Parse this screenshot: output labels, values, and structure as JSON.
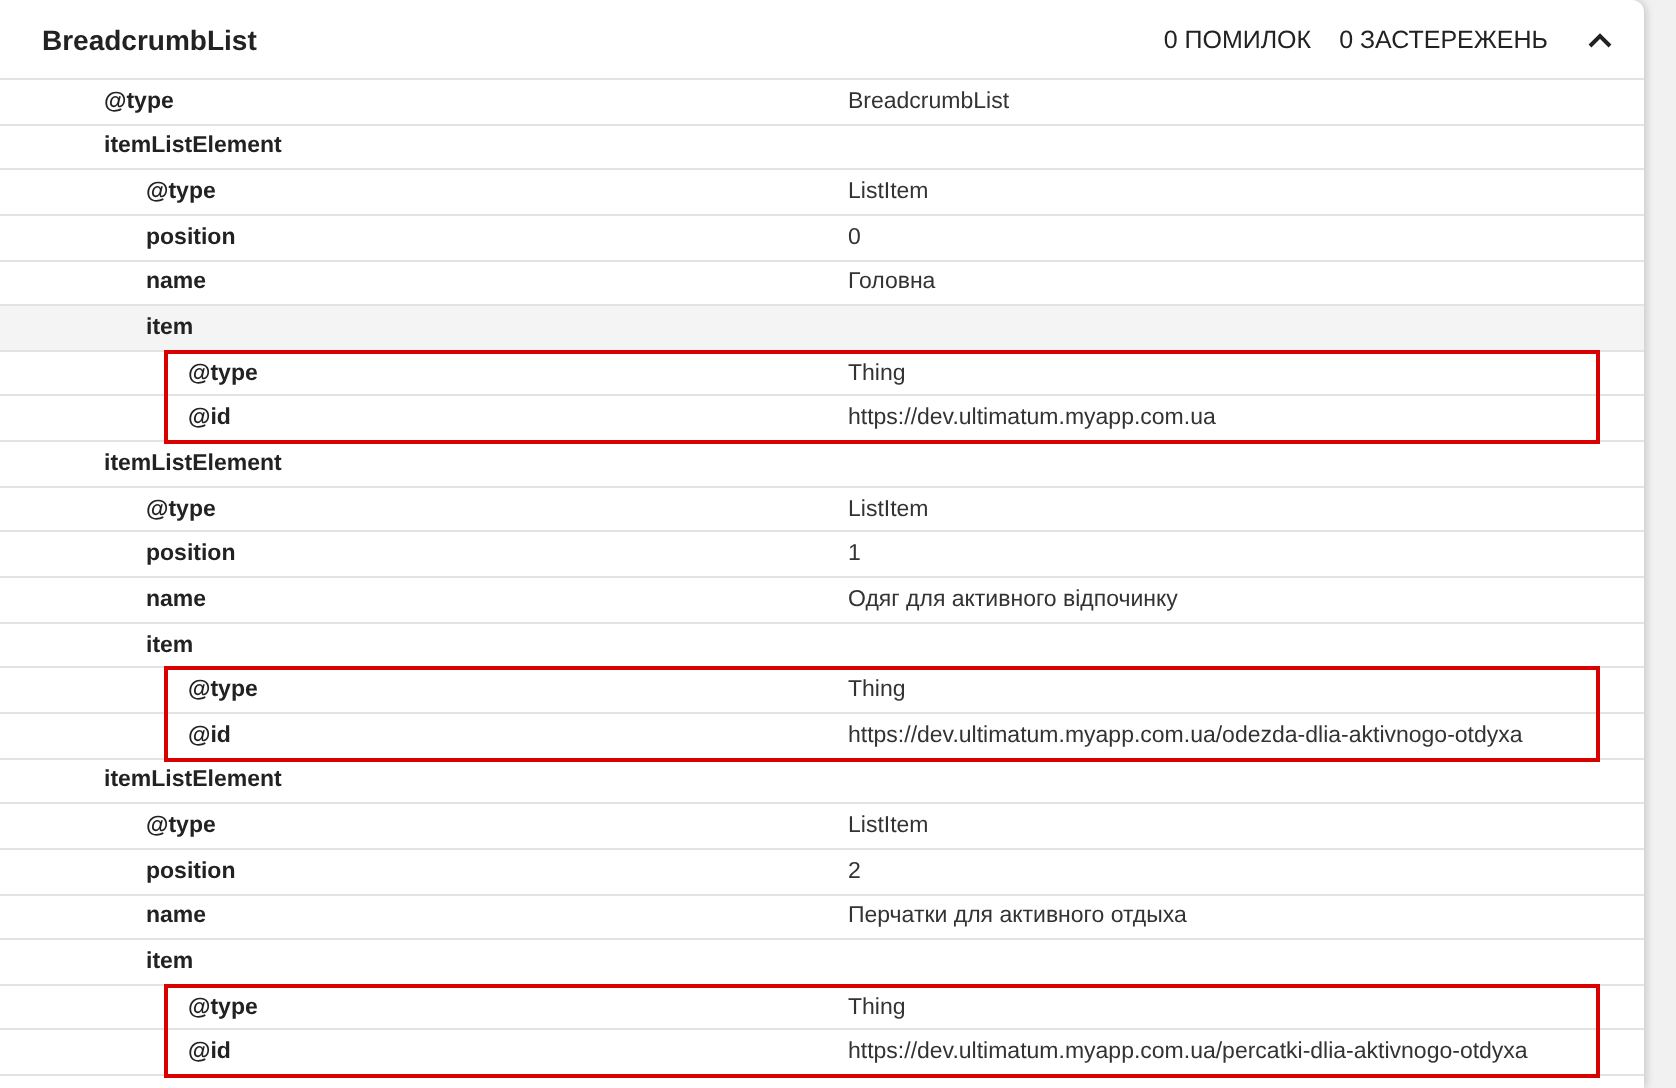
{
  "card": {
    "title": "BreadcrumbList",
    "errors": "0 ПОМИЛОК",
    "warnings": "0 ЗАСТЕРЕЖЕНЬ",
    "expanded": true
  },
  "rows": [
    {
      "key": "@type",
      "value": "BreadcrumbList"
    },
    {
      "key": "itemListElement",
      "children": [
        {
          "key": "@type",
          "value": "ListItem"
        },
        {
          "key": "position",
          "value": "0"
        },
        {
          "key": "name",
          "value": "Головна"
        },
        {
          "key": "item",
          "hovered": true,
          "highlighted": true,
          "children": [
            {
              "key": "@type",
              "value": "Thing"
            },
            {
              "key": "@id",
              "value": "https://dev.ultimatum.myapp.com.ua"
            }
          ]
        }
      ]
    },
    {
      "key": "itemListElement",
      "children": [
        {
          "key": "@type",
          "value": "ListItem"
        },
        {
          "key": "position",
          "value": "1"
        },
        {
          "key": "name",
          "value": "Одяг для активного відпочинку"
        },
        {
          "key": "item",
          "hovered": false,
          "highlighted": true,
          "children": [
            {
              "key": "@type",
              "value": "Thing"
            },
            {
              "key": "@id",
              "value": "https://dev.ultimatum.myapp.com.ua/odezda-dlia-aktivnogo-otdyxa"
            }
          ]
        }
      ]
    },
    {
      "key": "itemListElement",
      "children": [
        {
          "key": "@type",
          "value": "ListItem"
        },
        {
          "key": "position",
          "value": "2"
        },
        {
          "key": "name",
          "value": "Перчатки для активного отдыха"
        },
        {
          "key": "item",
          "hovered": false,
          "highlighted": true,
          "children": [
            {
              "key": "@type",
              "value": "Thing"
            },
            {
              "key": "@id",
              "value": "https://dev.ultimatum.myapp.com.ua/percatki-dlia-aktivnogo-otdyxa"
            }
          ]
        }
      ]
    }
  ]
}
